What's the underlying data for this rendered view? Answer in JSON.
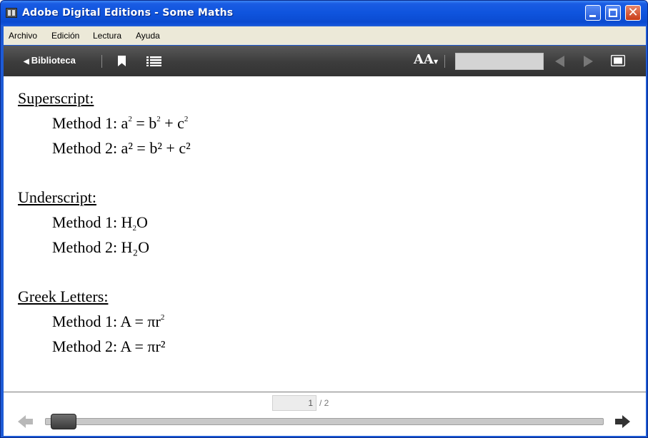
{
  "window": {
    "title": "Adobe Digital Editions - Some Maths",
    "close_glyph": "✕"
  },
  "menu": {
    "items": [
      "Archivo",
      "Edición",
      "Lectura",
      "Ayuda"
    ]
  },
  "toolbar": {
    "library_label": "Biblioteca",
    "font_size_label": "AA"
  },
  "document": {
    "sections": [
      {
        "heading": "Superscript:",
        "lines": [
          {
            "prefix": "Method 1: a",
            "a": "2",
            "b": " = b",
            "c": "2",
            "d": " + c",
            "e": "2"
          },
          {
            "text": "Method 2: a² = b² + c²"
          }
        ]
      },
      {
        "heading": "Underscript:",
        "lines": [
          {
            "prefix": "Method 1: H",
            "a": "2",
            "b": "O"
          },
          {
            "text": "Method 2: H₂O"
          }
        ]
      },
      {
        "heading": "Greek Letters:",
        "lines": [
          {
            "prefix": "Method 1: A = πr",
            "a": "2"
          },
          {
            "text": "Method 2: A = πr²"
          }
        ]
      }
    ]
  },
  "footer": {
    "current_page": "1",
    "total_pages": "/ 2",
    "slider_position": 0.0
  },
  "colors": {
    "titlebar": "#0f54de",
    "toolbar": "#3c3c3c",
    "menubar": "#ece9d8"
  }
}
